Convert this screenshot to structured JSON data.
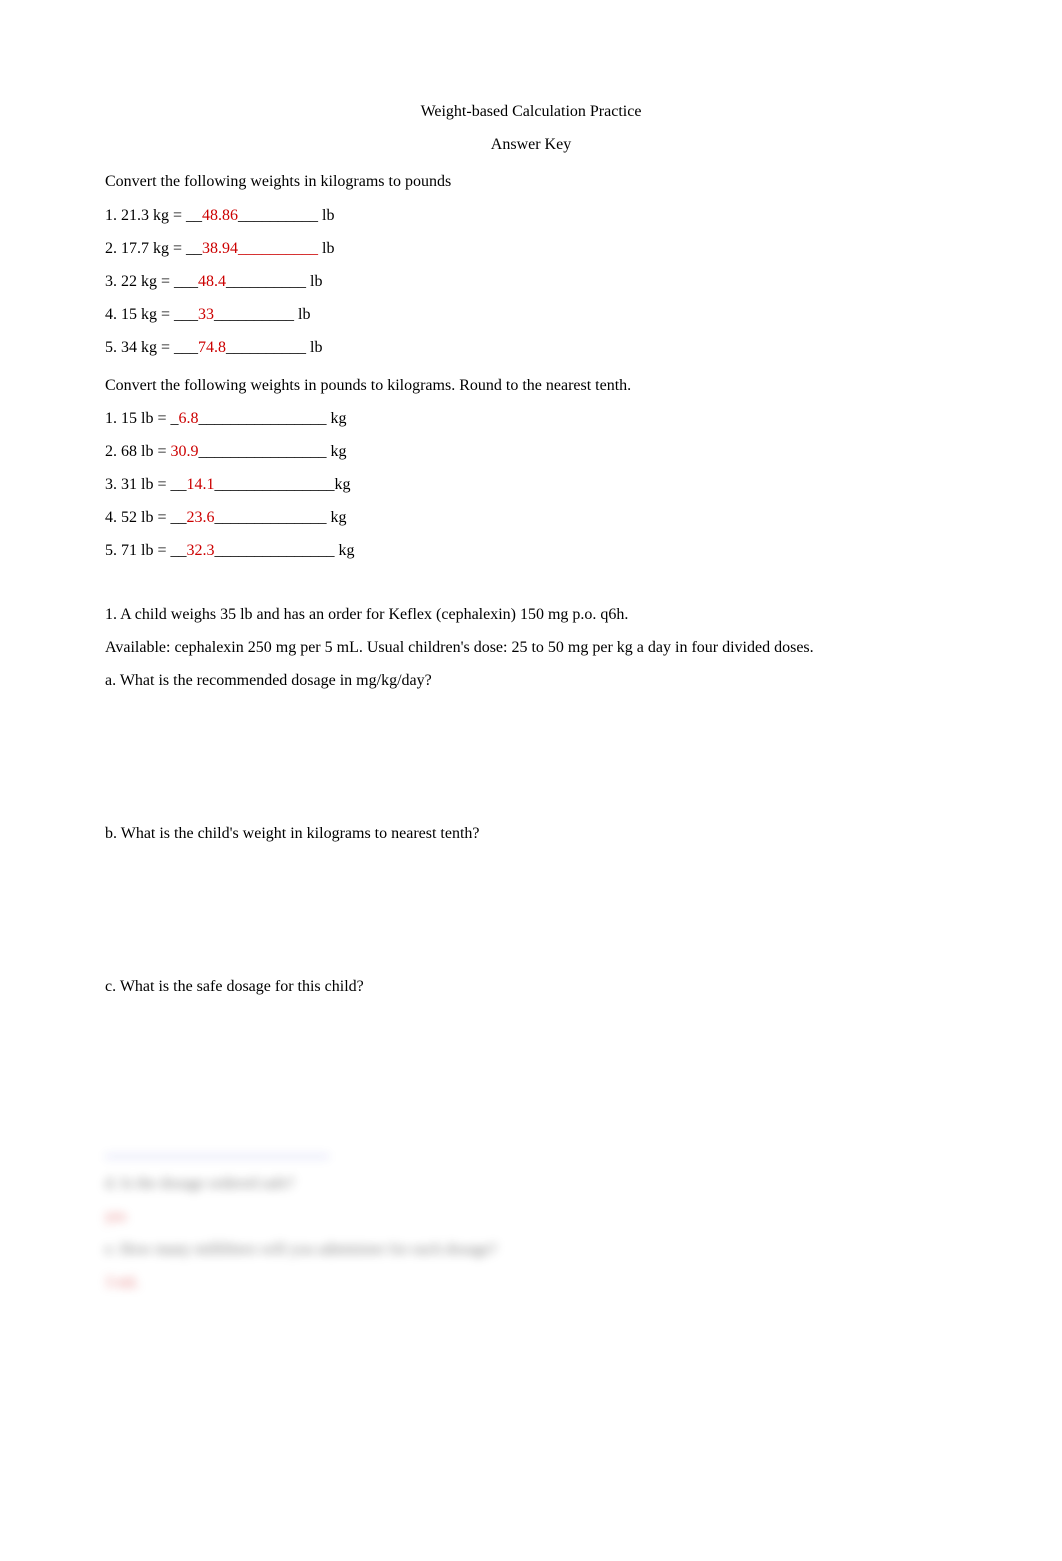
{
  "title_line1": "Weight-based Calculation Practice",
  "title_line2": "Answer Key",
  "section1_heading": "Convert the following weights in kilograms to pounds",
  "kg_to_lb": [
    {
      "prefix": "1. 21.3 kg = __",
      "answer": "48.86",
      "suffix": "__________ lb"
    },
    {
      "prefix": "2. 17.7 kg = __",
      "answer": "38.94__________",
      "suffix": " lb"
    },
    {
      "prefix": "3. 22 kg = ___",
      "answer": "48.4",
      "suffix": "__________ lb"
    },
    {
      "prefix": "4. 15 kg = ___",
      "answer": "33",
      "suffix": "__________ lb"
    },
    {
      "prefix": "5. 34 kg = ___",
      "answer": "74.8",
      "suffix": "__________ lb"
    }
  ],
  "section2_heading": "Convert the following weights in pounds to kilograms.  Round to the nearest tenth.",
  "lb_to_kg": [
    {
      "prefix": "1. 15 lb = _",
      "answer": "6.8",
      "suffix": "________________ kg"
    },
    {
      "prefix": "2. 68 lb = ",
      "answer": "30.9",
      "suffix": "________________ kg"
    },
    {
      "prefix": "3. 31 lb = __",
      "answer": "14.1",
      "suffix": "_______________kg"
    },
    {
      "prefix": "4. 52 lb = __",
      "answer": "23.6",
      "suffix": "______________ kg"
    },
    {
      "prefix": "5. 71 lb = __",
      "answer": "32.3",
      "suffix": "_______________ kg"
    }
  ],
  "problem1_line1": "1. A child weighs 35 lb and has an order for Keflex (cephalexin) 150 mg p.o. q6h.",
  "problem1_line2": "Available:  cephalexin 250 mg per 5 mL.  Usual children's dose: 25 to 50 mg per kg a day in four divided doses.",
  "q_a": "a. What is the recommended dosage in mg/kg/day?",
  "q_b": "b. What is the child's weight in kilograms to nearest tenth?",
  "q_c": "c. What is the safe dosage for this child?",
  "blur_text1": "d. Is the dosage ordered safe?",
  "blur_text2": "yes",
  "blur_text3": "e. How many milliliters will you administer for each dosage?",
  "blur_text4": "3 mL"
}
